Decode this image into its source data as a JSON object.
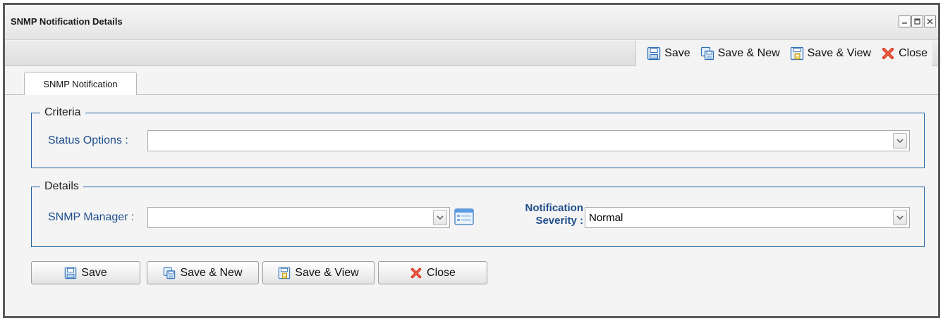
{
  "window": {
    "title": "SNMP Notification Details"
  },
  "toolbar": {
    "save_label": "Save",
    "save_new_label": "Save & New",
    "save_view_label": "Save & View",
    "close_label": "Close"
  },
  "tabs": [
    {
      "label": "SNMP Notification",
      "active": true
    }
  ],
  "criteria": {
    "legend": "Criteria",
    "status_options_label": "Status Options :",
    "status_options_value": ""
  },
  "details": {
    "legend": "Details",
    "snmp_manager_label": "SNMP Manager :",
    "snmp_manager_value": "",
    "severity_label_line1": "Notification",
    "severity_label_line2": "Severity :",
    "severity_value": "Normal"
  },
  "buttons": {
    "save_label": "Save",
    "save_new_label": "Save & New",
    "save_view_label": "Save & View",
    "close_label": "Close"
  },
  "colors": {
    "label_blue": "#1f4f8c",
    "fieldset_border": "#1f5fa0",
    "close_red": "#d9301c"
  }
}
